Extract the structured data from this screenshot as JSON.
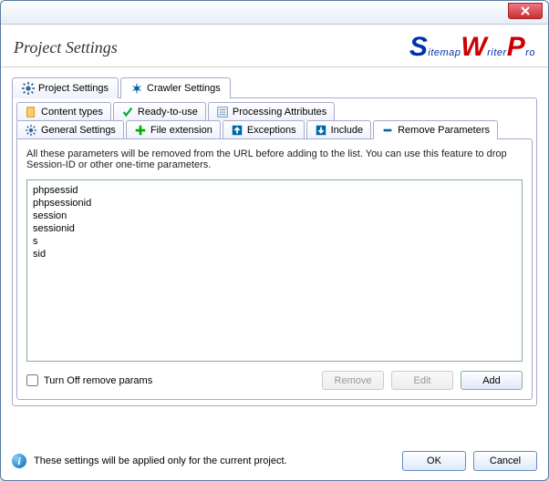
{
  "window": {
    "title": "Project Settings"
  },
  "logo": {
    "s": "S",
    "itemap": "itemap",
    "w": "W",
    "riter": "riter",
    "p": "P",
    "ro": "ro"
  },
  "main_tabs": [
    {
      "label": "Project Settings"
    },
    {
      "label": "Crawler Settings"
    }
  ],
  "main_selected": 1,
  "sub_tabs_row1": [
    {
      "label": "Content types"
    },
    {
      "label": "Ready-to-use"
    },
    {
      "label": "Processing Attributes"
    }
  ],
  "sub_tabs_row2": [
    {
      "label": "General Settings"
    },
    {
      "label": "File extension"
    },
    {
      "label": "Exceptions"
    },
    {
      "label": "Include"
    },
    {
      "label": "Remove Parameters"
    }
  ],
  "sub_selected": "Remove Parameters",
  "panel": {
    "description": "All these parameters will be removed from the URL before adding to the list. You can use this feature to drop Session-ID or other one-time parameters.",
    "items": [
      "phpsessid",
      "phpsessionid",
      "session",
      "sessionid",
      "s",
      "sid"
    ],
    "turn_off_label": "Turn Off remove params",
    "turn_off_checked": false,
    "buttons": {
      "remove": "Remove",
      "edit": "Edit",
      "add": "Add"
    }
  },
  "footer": {
    "info": "These settings will be applied only for the current project.",
    "ok": "OK",
    "cancel": "Cancel"
  }
}
